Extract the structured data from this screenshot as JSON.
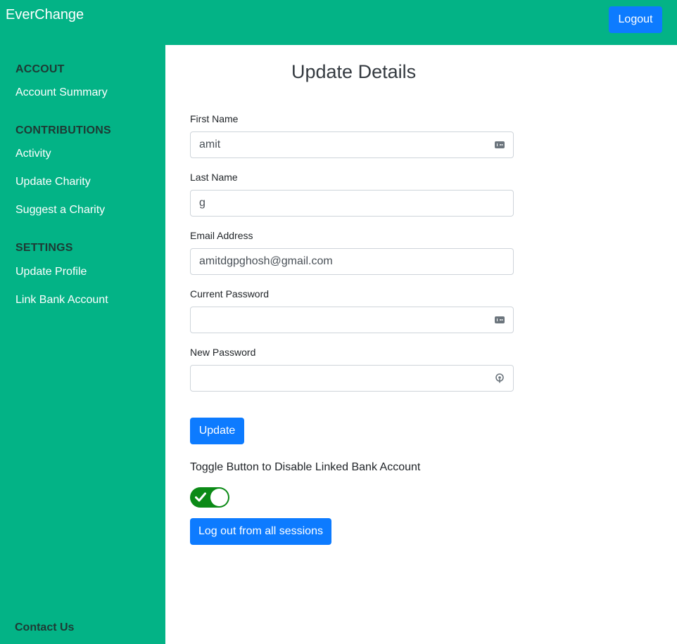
{
  "header": {
    "brand": "EverChange",
    "logout_label": "Logout"
  },
  "sidebar": {
    "sections": [
      {
        "heading": "ACCOUT",
        "items": [
          "Account Summary"
        ]
      },
      {
        "heading": "CONTRIBUTIONS",
        "items": [
          "Activity",
          "Update Charity",
          "Suggest a Charity"
        ]
      },
      {
        "heading": "SETTINGS",
        "items": [
          "Update Profile",
          "Link Bank Account"
        ]
      }
    ],
    "contact_label": "Contact Us"
  },
  "main": {
    "title": "Update Details",
    "fields": {
      "first_name": {
        "label": "First Name",
        "value": "amit",
        "icon": "password-manager-icon"
      },
      "last_name": {
        "label": "Last Name",
        "value": "g"
      },
      "email": {
        "label": "Email Address",
        "value": "amitdgpghosh@gmail.com"
      },
      "current_password": {
        "label": "Current Password",
        "value": "",
        "icon": "password-manager-icon"
      },
      "new_password": {
        "label": "New Password",
        "value": "",
        "icon": "key-generate-icon"
      }
    },
    "update_label": "Update",
    "toggle_label": "Toggle Button to Disable Linked Bank Account",
    "toggle_state": "on",
    "sessions_label": "Log out from all sessions"
  },
  "colors": {
    "brand_green": "#03b386",
    "primary_blue": "#0d7bff",
    "toggle_green": "#0b8a16"
  }
}
